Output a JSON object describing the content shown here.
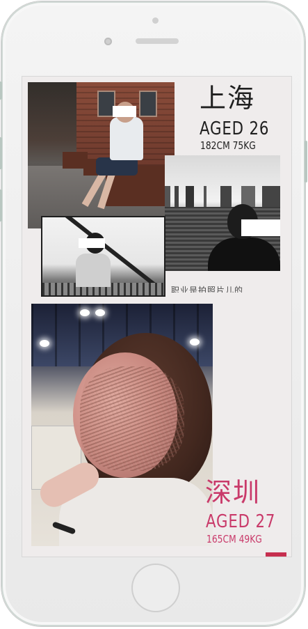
{
  "profile_1": {
    "city": "上海",
    "age": "AGED 26",
    "stats": "182CM 75KG",
    "caption": "职业是拍照片儿的"
  },
  "profile_2": {
    "city": "深圳",
    "age": "AGED 27",
    "stats": "165CM 49KG"
  },
  "colors": {
    "dark_text": "#1f1f1f",
    "accent_pink": "#c93a6a",
    "screen_bg": "#efecec",
    "accent_bar": "#c62f4f"
  },
  "icons": [
    "home-button",
    "front-camera-icon",
    "earpiece-speaker",
    "proximity-sensor"
  ]
}
